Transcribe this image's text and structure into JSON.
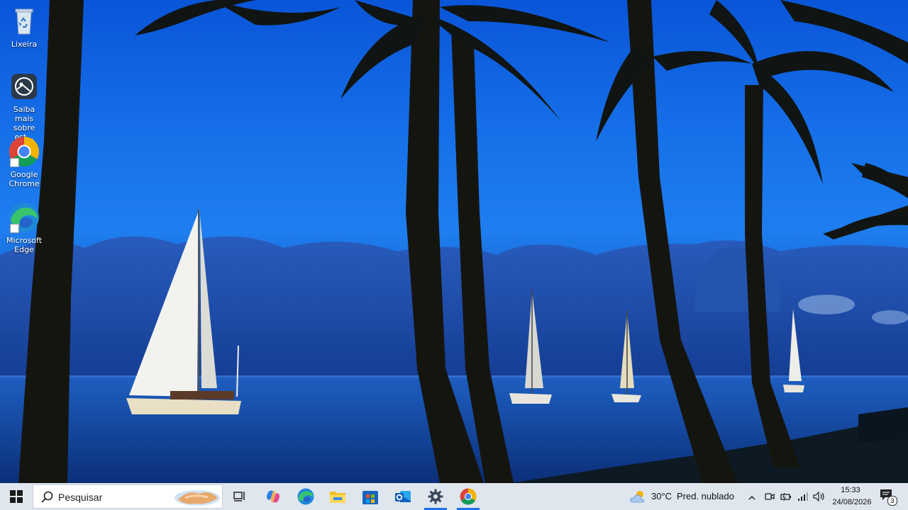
{
  "desktop": {
    "icons": [
      {
        "label": "Lixeira",
        "icon": "recycle-bin-icon"
      },
      {
        "label": "Saiba mais sobre est...",
        "icon": "learn-more-icon"
      },
      {
        "label": "Google Chrome",
        "icon": "chrome-icon"
      },
      {
        "label": "Microsoft Edge",
        "icon": "edge-icon"
      }
    ]
  },
  "taskbar": {
    "start_icon": "windows-icon",
    "search_placeholder": "Pesquisar",
    "pinned": [
      {
        "name": "task-view",
        "icon": "task-view-icon"
      },
      {
        "name": "copilot",
        "icon": "copilot-icon"
      },
      {
        "name": "edge",
        "icon": "edge-icon"
      },
      {
        "name": "file-explorer",
        "icon": "folder-icon"
      },
      {
        "name": "microsoft-store",
        "icon": "store-icon"
      },
      {
        "name": "outlook",
        "icon": "outlook-icon"
      },
      {
        "name": "settings",
        "icon": "gear-icon",
        "active": true
      },
      {
        "name": "chrome",
        "icon": "chrome-icon",
        "active": true
      }
    ],
    "weather": {
      "temperature": "30°C",
      "condition": "Pred. nublado",
      "icon": "partly-cloudy-icon"
    },
    "clock": {
      "time": "15:33",
      "date": "24/08/2026"
    },
    "notifications_count": "3",
    "colors": {
      "taskbar_bg": "#dfe6ee",
      "accent": "#1a73e8"
    }
  }
}
